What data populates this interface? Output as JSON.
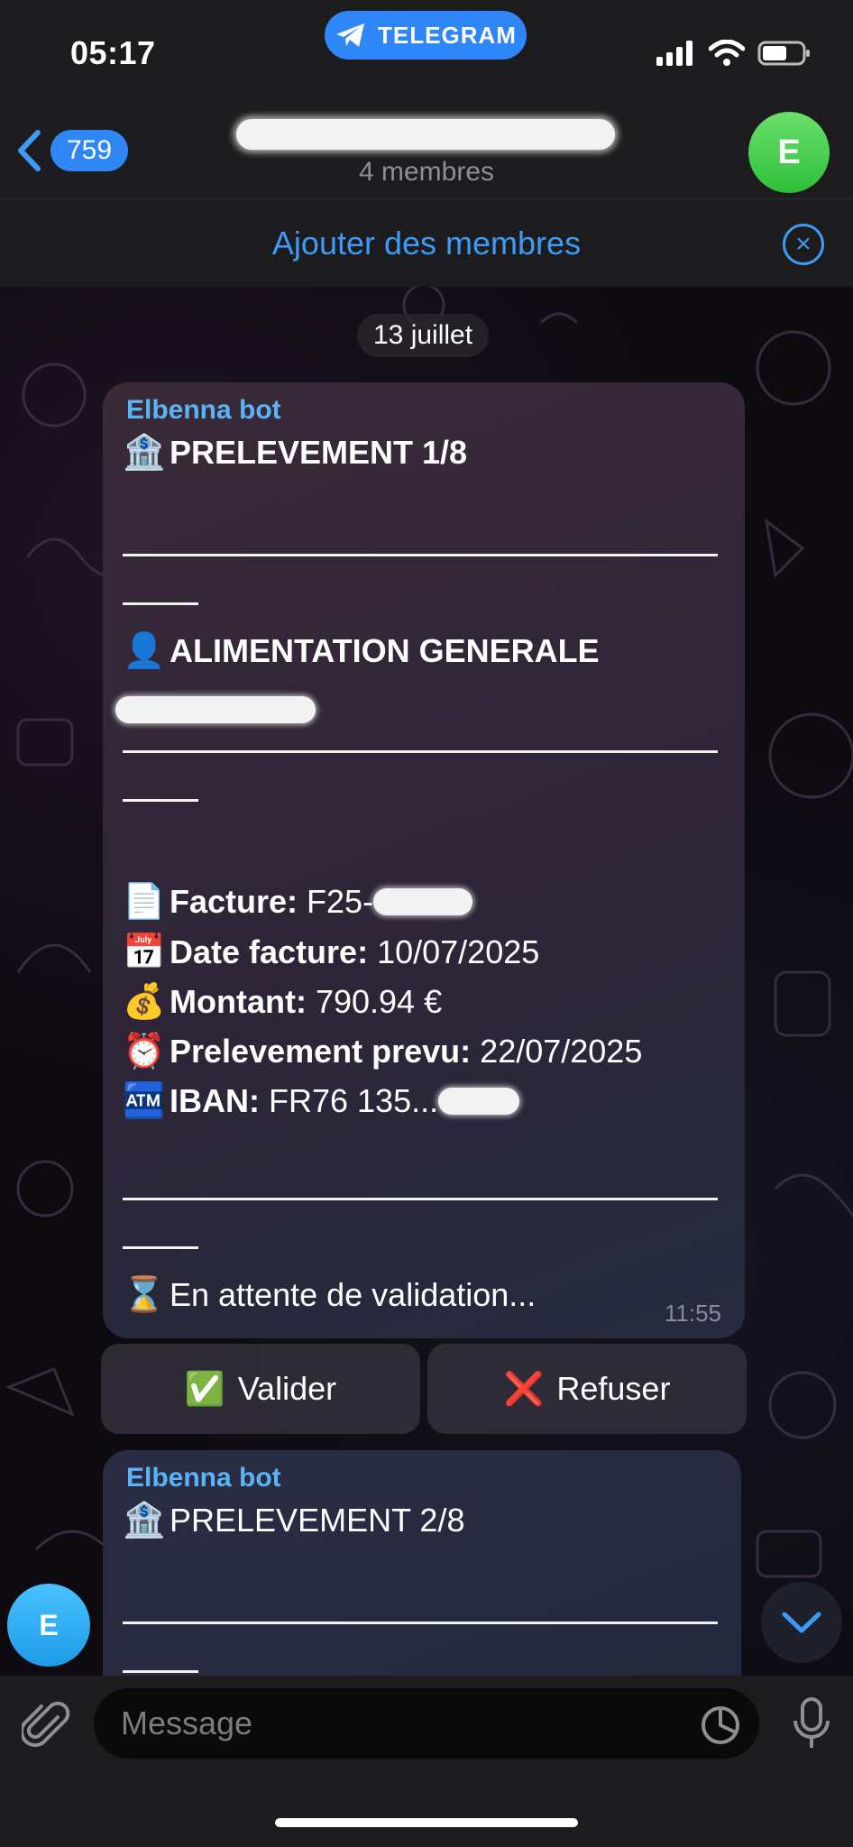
{
  "status_bar": {
    "time": "05:17",
    "telegram_label": "TELEGRAM"
  },
  "header": {
    "back_count": "759",
    "subtitle": "4 membres",
    "avatar_letter": "E"
  },
  "add_members": {
    "label": "Ajouter des membres"
  },
  "date_separator": "13 juillet",
  "message1": {
    "sender": "Elbenna bot",
    "title": "PRELEVEMENT 1/8",
    "client": "ALIMENTATION GENERALE",
    "facture_label": "Facture:",
    "facture_value": "F25-",
    "date_label": "Date facture:",
    "date_value": "10/07/2025",
    "montant_label": "Montant:",
    "montant_value": "790.94 €",
    "prelevement_label": "Prelevement prevu:",
    "prelevement_value": "22/07/2025",
    "iban_label": "IBAN:",
    "iban_value": "FR76 135...",
    "status": "En attente de validation...",
    "time": "11:55"
  },
  "buttons": {
    "validate_label": "Valider",
    "refuse_label": "Refuser"
  },
  "message2": {
    "sender": "Elbenna bot",
    "title": "PRELEVEMENT 2/8"
  },
  "floating_avatar_letter": "E",
  "composer": {
    "placeholder": "Message"
  },
  "emoji": {
    "bank": "🏦",
    "person": "👤",
    "document": "📄",
    "calendar": "📅",
    "money_bag": "💰",
    "alarm": "⏰",
    "atm": "🏧",
    "hourglass": "⌛",
    "check": "✅",
    "cross": "❌"
  },
  "colors": {
    "accent": "#2f86f6",
    "link": "#3e9bf5",
    "sender": "#5ab3f5",
    "header_bg": "#1c1b1d",
    "avatar_green": "#3ccf4a"
  }
}
